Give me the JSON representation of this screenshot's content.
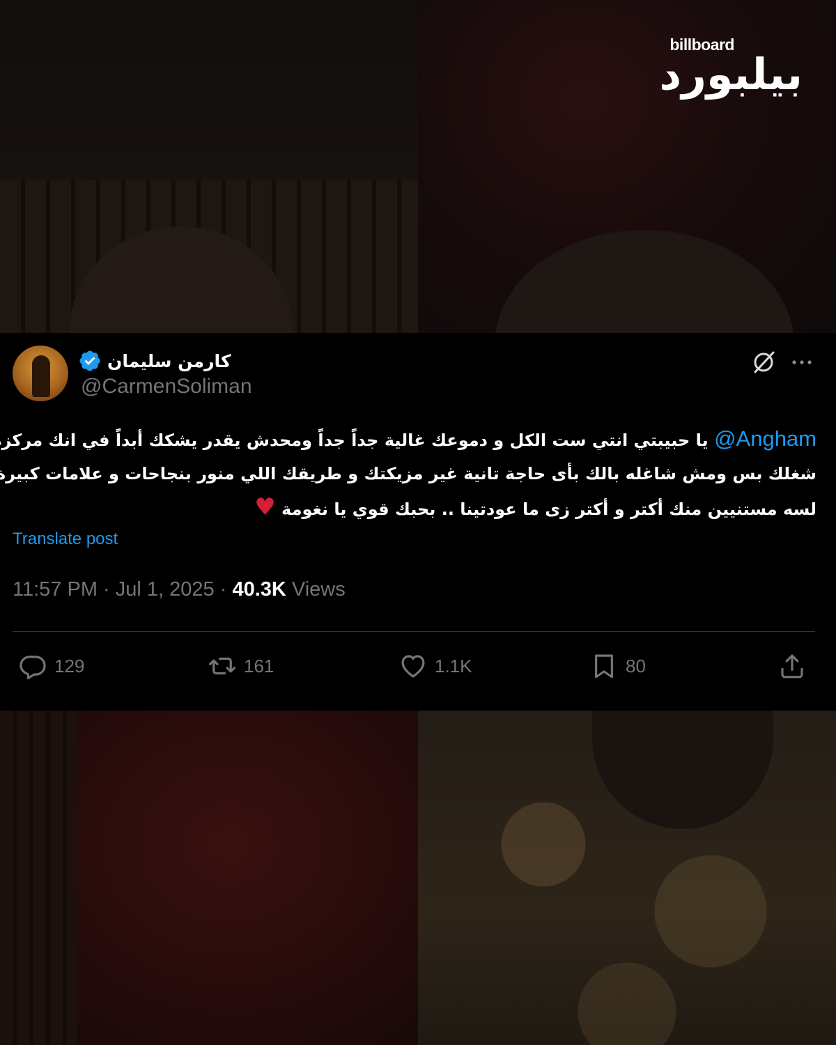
{
  "brand": {
    "logo_en": "billboard",
    "logo_ar": "بيلبورد"
  },
  "tweet": {
    "display_name": "كارمن سليمان",
    "handle": "@CarmenSoliman",
    "mention": "@Angham",
    "text_lines": [
      "يا حبيبتي انتي ست الكل و دموعك غالية جداً جداً ومحدش يقدر يشكك أبداً في انك مركزة في",
      "شغلك بس ومش شاغله بالك بأى حاجة تانية غير مزيكتك و طريقك اللي منور بنجاحات و علامات كبيرة و",
      "لسه مستنيين منك أكتر و أكتر زى ما عودتينا .. بحبك قوي يا نغومة"
    ],
    "heart_emoji": "♥",
    "translate_label": "Translate post",
    "time": "11:57 PM",
    "date": "Jul 1, 2025",
    "separator": "·",
    "views_count": "40.3K",
    "views_label": "Views",
    "replies": "129",
    "retweets": "161",
    "likes": "1.1K",
    "bookmarks": "80"
  },
  "icons": {
    "verified": "verified-badge-icon",
    "grok": "grok-icon",
    "more": "more-icon",
    "reply": "reply-icon",
    "retweet": "retweet-icon",
    "like": "heart-icon",
    "bookmark": "bookmark-icon",
    "share": "share-icon"
  },
  "colors": {
    "link": "#1d9bf0",
    "muted": "#71767b",
    "card_bg": "#000000",
    "heart": "#d41f36"
  }
}
